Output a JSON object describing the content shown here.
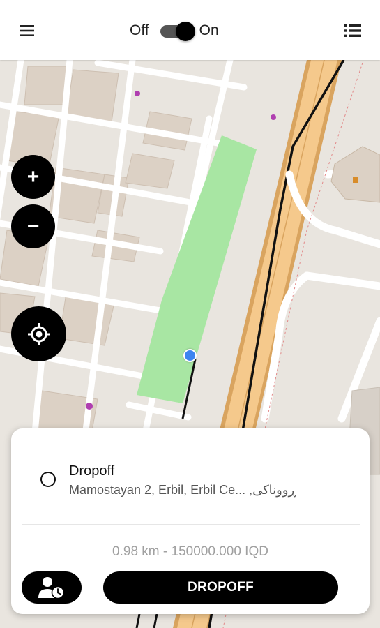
{
  "header": {
    "status_off_label": "Off",
    "status_on_label": "On",
    "online_toggle_on": true,
    "menu_icon": "hamburger-menu-icon",
    "list_icon": "list-icon"
  },
  "map": {
    "zoom_in_label": "+",
    "zoom_out_label": "−",
    "locate_icon": "crosshair-icon",
    "current_location_color": "#3d84f0",
    "park_color": "#a8e6a3",
    "highway_color": "#f5c98c"
  },
  "trip": {
    "stop_title": "Dropoff",
    "stop_address": "Mamostayan 2, Erbil, Erbil Ce... ,ڕووناکی",
    "distance_price": "0.98 km - 150000.000 IQD",
    "schedule_icon": "user-clock-icon",
    "action_label": "DROPOFF"
  }
}
